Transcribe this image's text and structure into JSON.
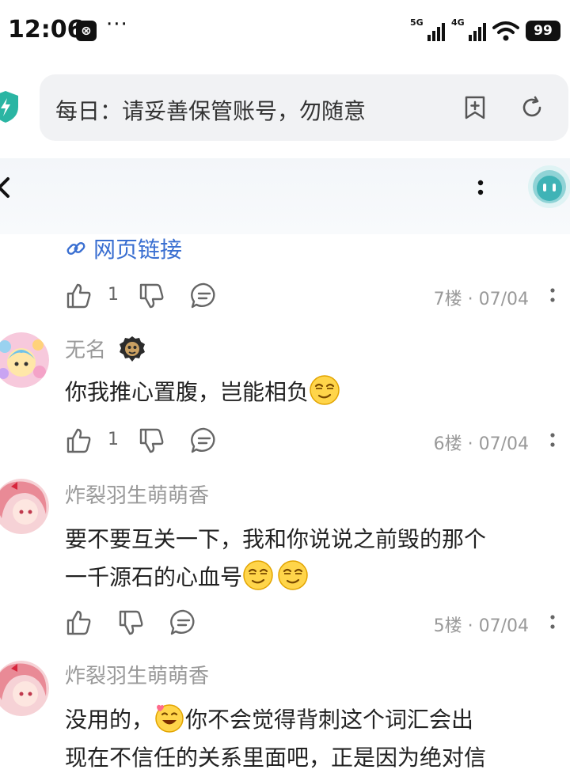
{
  "status_bar": {
    "time": "12:06",
    "app_badge": "⊗",
    "more": "···",
    "net1": "5G",
    "net2": "4G",
    "battery": "99"
  },
  "browser": {
    "address_text": "每日：请妥善保管账号，勿随意"
  },
  "link": {
    "label": "网页链接"
  },
  "comments": [
    {
      "likes": "1",
      "floor": "7楼",
      "date": "07/04"
    },
    {
      "username": "无名",
      "text": "你我推心置腹，岂能相负",
      "likes": "1",
      "floor": "6楼",
      "date": "07/04"
    },
    {
      "username": "炸裂羽生萌萌香",
      "text_line1": "要不要互关一下，我和你说说之前毁的那个",
      "text_line2": "一千源石的心血号",
      "likes": "",
      "floor": "5楼",
      "date": "07/04"
    },
    {
      "username": "炸裂羽生萌萌香",
      "text_a": "没用的，",
      "text_b": "你不会觉得背刺这个词汇会出",
      "text_line2": "现在不信任的关系里面吧，正是因为绝对信"
    }
  ],
  "colors": {
    "link": "#3a6fd1",
    "muted": "#999999",
    "accent": "#2ab5a3"
  }
}
